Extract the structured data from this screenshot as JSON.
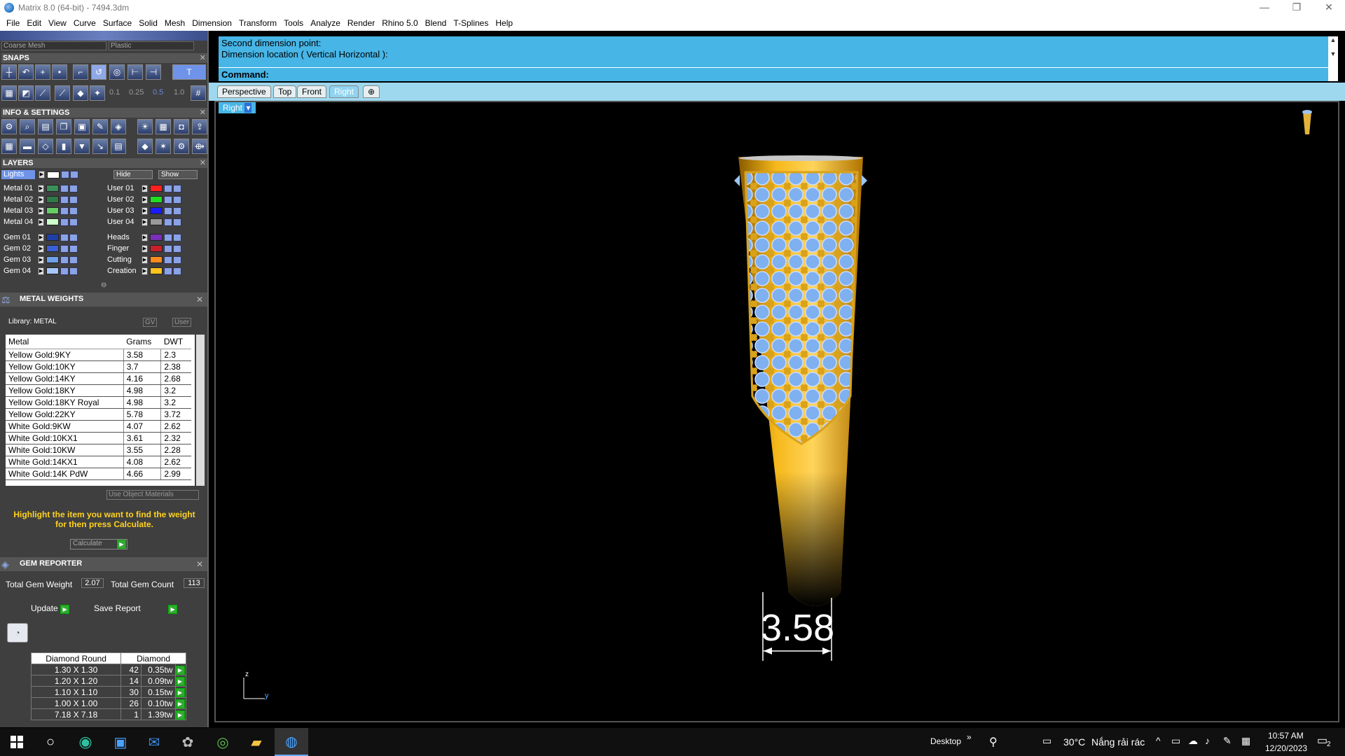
{
  "window": {
    "title": "Matrix 8.0 (64-bit) - 7494.3dm",
    "min": "—",
    "max": "❐",
    "close": "✕"
  },
  "menu": [
    "File",
    "Edit",
    "View",
    "Curve",
    "Surface",
    "Solid",
    "Mesh",
    "Dimension",
    "Transform",
    "Tools",
    "Analyze",
    "Render",
    "Rhino 5.0",
    "Blend",
    "T-Splines",
    "Help"
  ],
  "toolbar_top": {
    "mesh": "Coarse Mesh",
    "material": "Plastic"
  },
  "panels": {
    "snaps": "SNAPS",
    "info_settings": "INFO & SETTINGS",
    "layers": "LAYERS",
    "metal_weights": "METAL WEIGHTS",
    "gem_reporter": "GEM REPORTER"
  },
  "snap_values": [
    "0.1",
    "0.25",
    "0.5",
    "1.0"
  ],
  "layers": {
    "lights": "Lights",
    "hide": "Hide",
    "show": "Show",
    "left": [
      {
        "name": "Metal 01",
        "color": "#3a8f5a"
      },
      {
        "name": "Metal 02",
        "color": "#2f7a49"
      },
      {
        "name": "Metal 03",
        "color": "#66cc66"
      },
      {
        "name": "Metal 04",
        "color": "#ccffcc"
      },
      {
        "name": "Gem 01",
        "color": "#1f3fa8"
      },
      {
        "name": "Gem 02",
        "color": "#3a5fd6"
      },
      {
        "name": "Gem 03",
        "color": "#6fa0ee"
      },
      {
        "name": "Gem 04",
        "color": "#a6c8ff"
      }
    ],
    "right": [
      {
        "name": "User 01",
        "color": "#ff2020"
      },
      {
        "name": "User 02",
        "color": "#22dd22"
      },
      {
        "name": "User 03",
        "color": "#1a1aff"
      },
      {
        "name": "User 04",
        "color": "#9a9a9a"
      },
      {
        "name": "Heads",
        "color": "#7a2fb8"
      },
      {
        "name": "Finger",
        "color": "#c8202a"
      },
      {
        "name": "Cutting",
        "color": "#ff8a1f"
      },
      {
        "name": "Creation",
        "color": "#ffc21f"
      }
    ]
  },
  "metal_weights": {
    "library": "Library: METAL",
    "gv": "GV",
    "user": "User",
    "headers": [
      "Metal",
      "Grams",
      "DWT"
    ],
    "rows": [
      [
        "Yellow Gold:9KY",
        "3.58",
        "2.3"
      ],
      [
        "Yellow Gold:10KY",
        "3.7",
        "2.38"
      ],
      [
        "Yellow Gold:14KY",
        "4.16",
        "2.68"
      ],
      [
        "Yellow Gold:18KY",
        "4.98",
        "3.2"
      ],
      [
        "Yellow Gold:18KY Royal",
        "4.98",
        "3.2"
      ],
      [
        "Yellow Gold:22KY",
        "5.78",
        "3.72"
      ],
      [
        "White Gold:9KW",
        "4.07",
        "2.62"
      ],
      [
        "White Gold:10KX1",
        "3.61",
        "2.32"
      ],
      [
        "White Gold:10KW",
        "3.55",
        "2.28"
      ],
      [
        "White Gold:14KX1",
        "4.08",
        "2.62"
      ],
      [
        "White Gold:14K PdW",
        "4.66",
        "2.99"
      ]
    ],
    "use_object_materials": "Use Object Materials",
    "hint": "Highlight the item you want to find the weight for then press Calculate.",
    "calculate": "Calculate"
  },
  "gem_reporter": {
    "total_weight_label": "Total Gem Weight",
    "total_weight": "2.07",
    "total_count_label": "Total Gem Count",
    "total_count": "113",
    "update": "Update",
    "save_report": "Save Report",
    "headers": [
      "Diamond Round",
      "Diamond"
    ],
    "rows": [
      [
        "1.30 X 1.30",
        "42",
        "0.35tw"
      ],
      [
        "1.20 X 1.20",
        "14",
        "0.09tw"
      ],
      [
        "1.10 X 1.10",
        "30",
        "0.15tw"
      ],
      [
        "1.00 X 1.00",
        "26",
        "0.10tw"
      ],
      [
        "7.18 X 7.18",
        "1",
        "1.39tw"
      ]
    ]
  },
  "command": {
    "line1": "Second dimension point:",
    "line2": "Dimension location ( Vertical  Horizontal ):",
    "prompt": "Command:"
  },
  "view_tabs": [
    "Perspective",
    "Top",
    "Front",
    "Right"
  ],
  "active_view": "Right",
  "viewport": {
    "label": "Right",
    "dimension": "3.58",
    "axis_z": "z",
    "axis_y": "y"
  },
  "taskbar": {
    "desktop": "Desktop",
    "temperature": "30°C",
    "weather": "Nắng rải rác",
    "time": "10:57 AM",
    "date": "12/20/2023",
    "notifications": "2"
  }
}
